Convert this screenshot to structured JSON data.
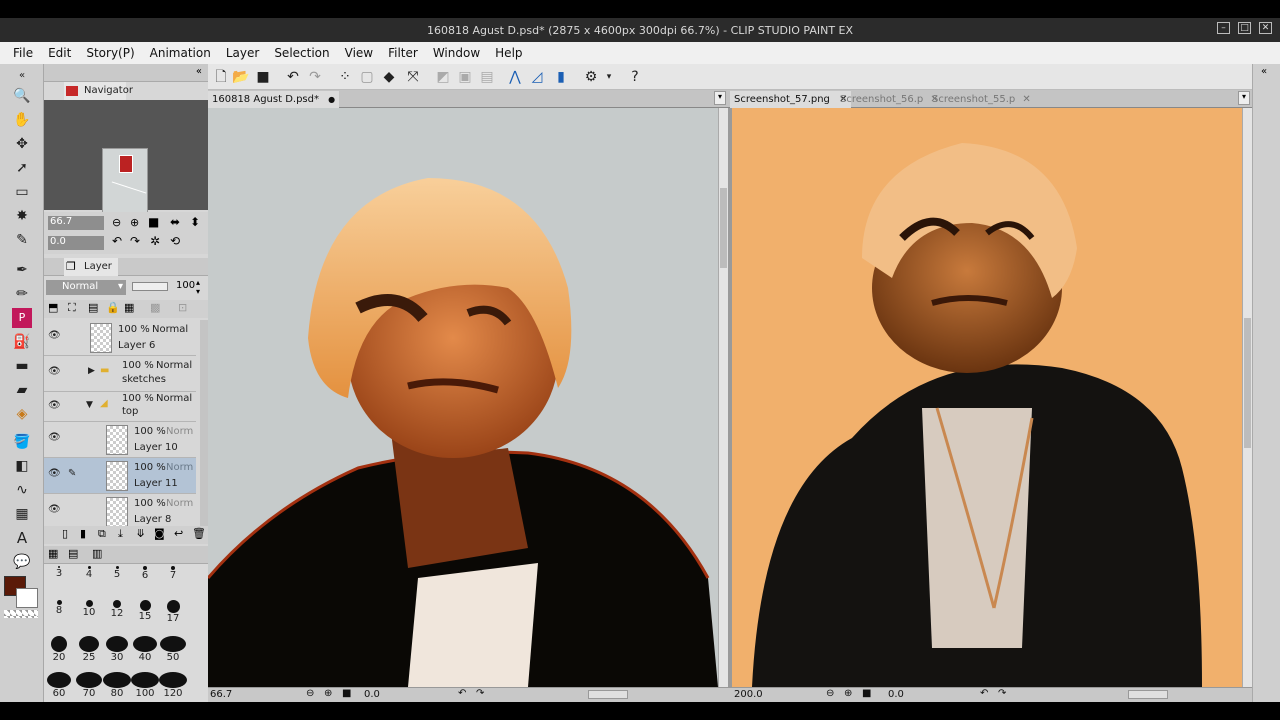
{
  "window": {
    "title": "160818 Agust D.psd* (2875 x 4600px 300dpi 66.7%) - CLIP STUDIO PAINT EX"
  },
  "menu": [
    "File",
    "Edit",
    "Story(P)",
    "Animation",
    "Layer",
    "Selection",
    "View",
    "Filter",
    "Window",
    "Help"
  ],
  "navigator": {
    "tab_label": "Navigator",
    "zoom": "66.7",
    "rotation": "0.0"
  },
  "layer_panel": {
    "tab_label": "Layer",
    "blend_mode": "Normal",
    "opacity": "100",
    "layers": [
      {
        "opacity": "100 %",
        "mode": "Normal",
        "name": "Layer 6"
      },
      {
        "opacity": "100 %",
        "mode": "Normal",
        "name": "sketches"
      },
      {
        "opacity": "100 %",
        "mode": "Normal",
        "name": "top"
      },
      {
        "opacity": "100 %",
        "mode": "Norm",
        "name": "Layer 10"
      },
      {
        "opacity": "100 %",
        "mode": "Norm",
        "name": "Layer 11"
      },
      {
        "opacity": "100 %",
        "mode": "Norm",
        "name": "Layer 8"
      }
    ]
  },
  "brush_sizes": [
    "3",
    "4",
    "5",
    "6",
    "7",
    "8",
    "10",
    "12",
    "15",
    "17",
    "20",
    "25",
    "30",
    "40",
    "50",
    "60",
    "70",
    "80",
    "100",
    "120"
  ],
  "colors": {
    "main_color": "#5a1a08",
    "sub_color": "#ffffff"
  },
  "left_doc": {
    "tab": "160818 Agust D.psd*",
    "zoom": "66.7",
    "rotation": "0.0"
  },
  "right_doc": {
    "tabs": [
      "Screenshot_57.png",
      "Screenshot_56.p",
      "Screenshot_55.p"
    ],
    "zoom": "200.0",
    "rotation": "0.0"
  }
}
